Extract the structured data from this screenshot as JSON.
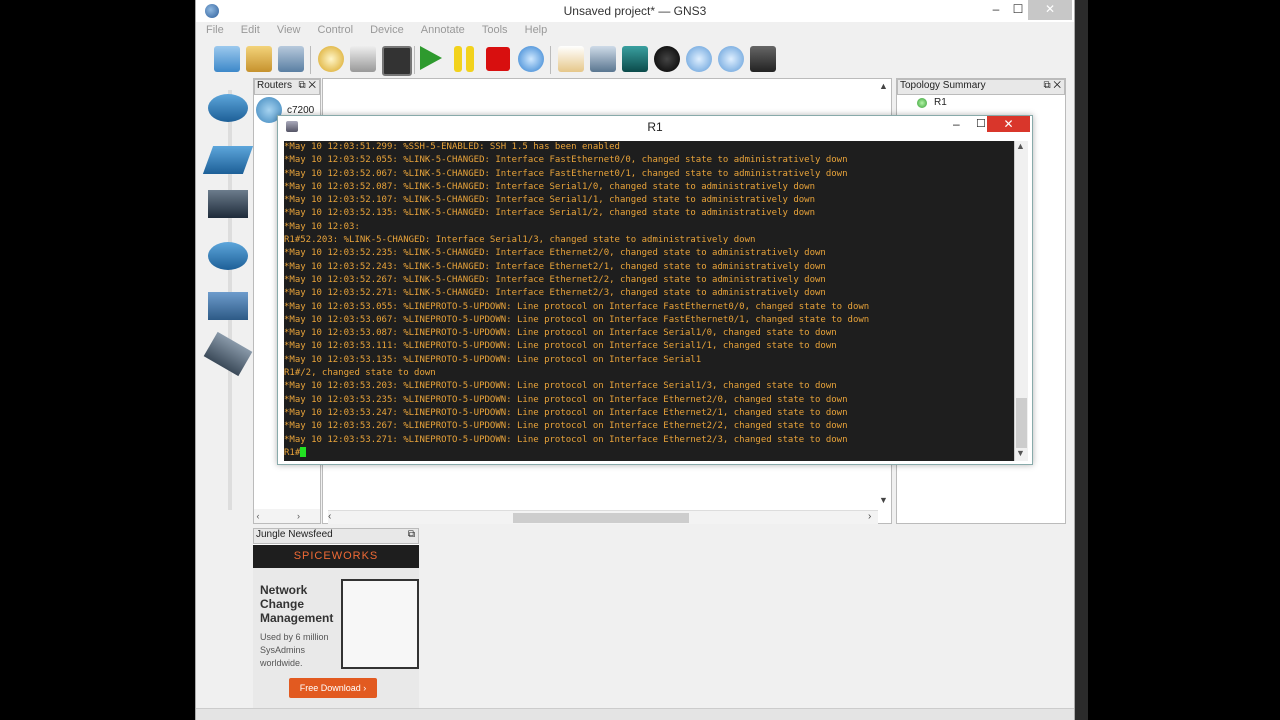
{
  "window": {
    "title": "Unsaved project* — GNS3",
    "colors": {
      "terminal_bg": "#1e1e1e",
      "terminal_text": "#e8a33a",
      "cursor": "#22e022"
    }
  },
  "menu": [
    "File",
    "Edit",
    "View",
    "Control",
    "Device",
    "Annotate",
    "Tools",
    "Help"
  ],
  "toolbar": [
    "new-project-icon",
    "open-project-icon",
    "save-project-icon",
    "snapshot-icon",
    "show-interface-labels-icon",
    "console-all-icon",
    "start-all-icon",
    "suspend-all-icon",
    "stop-all-icon",
    "reload-all-icon",
    "add-note-icon",
    "insert-picture-icon",
    "draw-rectangle-icon",
    "draw-ellipse-icon",
    "zoom-in-icon",
    "zoom-out-icon",
    "screenshot-icon"
  ],
  "routers_dock": {
    "title": "Routers",
    "item": "c7200"
  },
  "topology": {
    "title": "Topology Summary",
    "node": "R1"
  },
  "news": {
    "title": "Jungle Newsfeed",
    "brand": "SPICEWORKS",
    "headline": "Network Change Management",
    "sub": "Used by 6 million SysAdmins worldwide.",
    "cta": "Free Download"
  },
  "terminal": {
    "title": "R1",
    "lines": [
      "*May 10 12:03:51.299: %SSH-5-ENABLED: SSH 1.5 has been enabled",
      "*May 10 12:03:52.055: %LINK-5-CHANGED: Interface FastEthernet0/0, changed state to administratively down",
      "*May 10 12:03:52.067: %LINK-5-CHANGED: Interface FastEthernet0/1, changed state to administratively down",
      "*May 10 12:03:52.087: %LINK-5-CHANGED: Interface Serial1/0, changed state to administratively down",
      "*May 10 12:03:52.107: %LINK-5-CHANGED: Interface Serial1/1, changed state to administratively down",
      "*May 10 12:03:52.135: %LINK-5-CHANGED: Interface Serial1/2, changed state to administratively down",
      "*May 10 12:03:",
      "R1#52.203: %LINK-5-CHANGED: Interface Serial1/3, changed state to administratively down",
      "*May 10 12:03:52.235: %LINK-5-CHANGED: Interface Ethernet2/0, changed state to administratively down",
      "*May 10 12:03:52.243: %LINK-5-CHANGED: Interface Ethernet2/1, changed state to administratively down",
      "*May 10 12:03:52.267: %LINK-5-CHANGED: Interface Ethernet2/2, changed state to administratively down",
      "*May 10 12:03:52.271: %LINK-5-CHANGED: Interface Ethernet2/3, changed state to administratively down",
      "*May 10 12:03:53.055: %LINEPROTO-5-UPDOWN: Line protocol on Interface FastEthernet0/0, changed state to down",
      "*May 10 12:03:53.067: %LINEPROTO-5-UPDOWN: Line protocol on Interface FastEthernet0/1, changed state to down",
      "*May 10 12:03:53.087: %LINEPROTO-5-UPDOWN: Line protocol on Interface Serial1/0, changed state to down",
      "*May 10 12:03:53.111: %LINEPROTO-5-UPDOWN: Line protocol on Interface Serial1/1, changed state to down",
      "*May 10 12:03:53.135: %LINEPROTO-5-UPDOWN: Line protocol on Interface Serial1",
      "R1#/2, changed state to down",
      "*May 10 12:03:53.203: %LINEPROTO-5-UPDOWN: Line protocol on Interface Serial1/3, changed state to down",
      "*May 10 12:03:53.235: %LINEPROTO-5-UPDOWN: Line protocol on Interface Ethernet2/0, changed state to down",
      "*May 10 12:03:53.247: %LINEPROTO-5-UPDOWN: Line protocol on Interface Ethernet2/1, changed state to down",
      "*May 10 12:03:53.267: %LINEPROTO-5-UPDOWN: Line protocol on Interface Ethernet2/2, changed state to down",
      "*May 10 12:03:53.271: %LINEPROTO-5-UPDOWN: Line protocol on Interface Ethernet2/3, changed state to down"
    ],
    "prompt": "R1#"
  }
}
